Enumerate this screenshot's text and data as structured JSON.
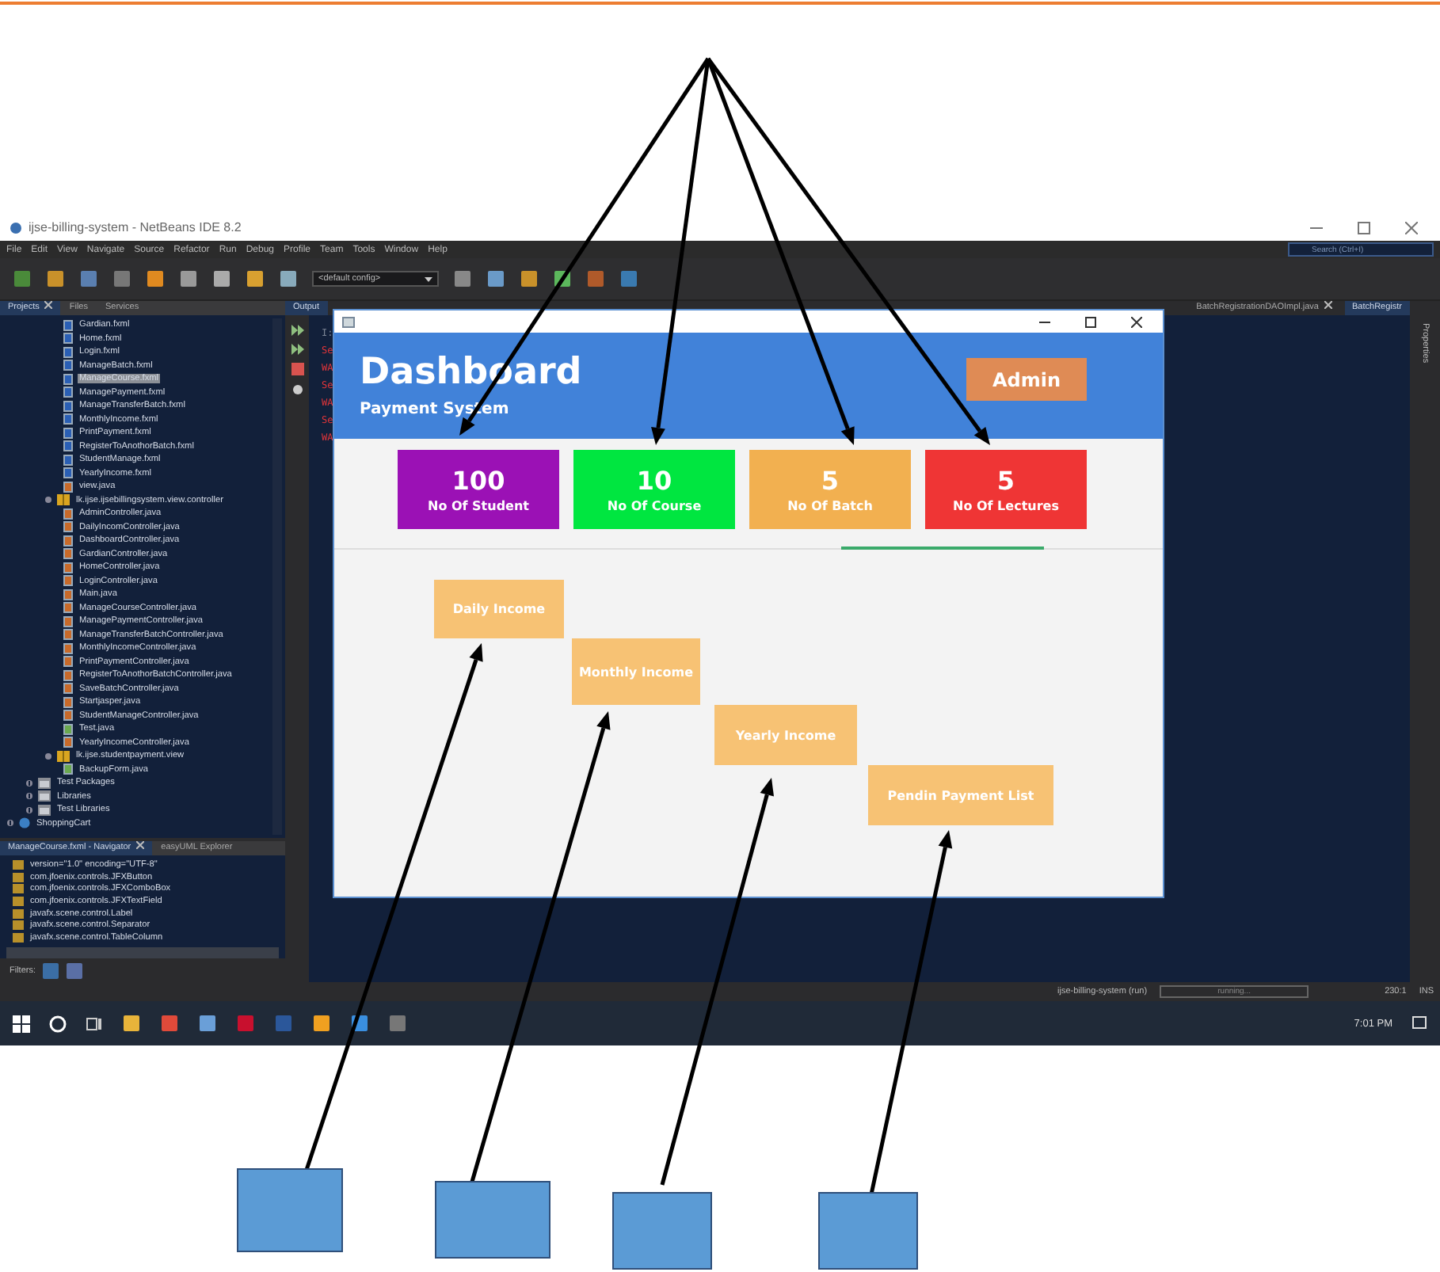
{
  "ide": {
    "title": "ijse-billing-system - NetBeans IDE 8.2",
    "menu": [
      "File",
      "Edit",
      "View",
      "Navigate",
      "Source",
      "Refactor",
      "Run",
      "Debug",
      "Profile",
      "Team",
      "Tools",
      "Window",
      "Help"
    ],
    "search": {
      "placeholder": "Search (Ctrl+I)"
    },
    "config": "<default config>",
    "left_tabs": [
      {
        "label": "Projects",
        "selected": true,
        "closable": true
      },
      {
        "label": "Files",
        "selected": false,
        "closable": false
      },
      {
        "label": "Services",
        "selected": false,
        "closable": false
      }
    ],
    "open_package_files": [
      {
        "label": "Gardian.fxml",
        "kind": "fxml",
        "selected": false
      },
      {
        "label": "Home.fxml",
        "kind": "fxml",
        "selected": false
      },
      {
        "label": "Login.fxml",
        "kind": "fxml",
        "selected": false
      },
      {
        "label": "ManageBatch.fxml",
        "kind": "fxml",
        "selected": false
      },
      {
        "label": "ManageCourse.fxml",
        "kind": "fxml",
        "selected": true
      },
      {
        "label": "ManagePayment.fxml",
        "kind": "fxml",
        "selected": false
      },
      {
        "label": "ManageTransferBatch.fxml",
        "kind": "fxml",
        "selected": false
      },
      {
        "label": "MonthlyIncome.fxml",
        "kind": "fxml",
        "selected": false
      },
      {
        "label": "PrintPayment.fxml",
        "kind": "fxml",
        "selected": false
      },
      {
        "label": "RegisterToAnothorBatch.fxml",
        "kind": "fxml",
        "selected": false
      },
      {
        "label": "StudentManage.fxml",
        "kind": "fxml",
        "selected": false
      },
      {
        "label": "YearlyIncome.fxml",
        "kind": "fxml",
        "selected": false
      },
      {
        "label": "view.java",
        "kind": "java",
        "selected": false
      }
    ],
    "packages": [
      {
        "label": "lk.ijse.ijsebillingsystem.view.controller",
        "expanded": true,
        "children": [
          {
            "label": "AdminController.java",
            "kind": "java",
            "selected": false
          },
          {
            "label": "DailyIncomController.java",
            "kind": "java",
            "selected": false
          },
          {
            "label": "DashboardController.java",
            "kind": "java",
            "selected": false
          },
          {
            "label": "GardianController.java",
            "kind": "java",
            "selected": false
          },
          {
            "label": "HomeController.java",
            "kind": "java",
            "selected": false
          },
          {
            "label": "LoginController.java",
            "kind": "java",
            "selected": false
          },
          {
            "label": "Main.java",
            "kind": "java",
            "selected": false
          },
          {
            "label": "ManageCourseController.java",
            "kind": "java",
            "selected": false
          },
          {
            "label": "ManagePaymentController.java",
            "kind": "java",
            "selected": false
          },
          {
            "label": "ManageTransferBatchController.java",
            "kind": "java",
            "selected": false
          },
          {
            "label": "MonthlyIncomeController.java",
            "kind": "java",
            "selected": false
          },
          {
            "label": "PrintPaymentController.java",
            "kind": "java",
            "selected": false
          },
          {
            "label": "RegisterToAnothorBatchController.java",
            "kind": "java",
            "selected": false
          },
          {
            "label": "SaveBatchController.java",
            "kind": "java",
            "selected": false
          },
          {
            "label": "Startjasper.java",
            "kind": "java",
            "selected": false
          },
          {
            "label": "StudentManageController.java",
            "kind": "java",
            "selected": false
          },
          {
            "label": "Test.java",
            "kind": "form",
            "selected": false
          },
          {
            "label": "YearlyIncomeController.java",
            "kind": "java",
            "selected": false
          }
        ]
      },
      {
        "label": "lk.ijse.studentpayment.view",
        "expanded": true,
        "children": [
          {
            "label": "BackupForm.java",
            "kind": "form",
            "selected": false
          }
        ]
      }
    ],
    "project_folders": [
      {
        "label": "Test Packages",
        "expanded": false
      },
      {
        "label": "Libraries",
        "expanded": false
      },
      {
        "label": "Test Libraries",
        "expanded": false
      }
    ],
    "other_projects": [
      {
        "label": "ShoppingCart",
        "expanded": false
      }
    ],
    "navigator_tabs": [
      {
        "label": "ManageCourse.fxml - Navigator",
        "selected": true,
        "closable": true
      },
      {
        "label": "easyUML Explorer",
        "selected": false,
        "closable": false
      }
    ],
    "navigator_items": [
      "version=\"1.0\" encoding=\"UTF-8\"",
      "com.jfoenix.controls.JFXButton",
      "com.jfoenix.controls.JFXComboBox",
      "com.jfoenix.controls.JFXTextField",
      "javafx.scene.control.Label",
      "javafx.scene.control.Separator",
      "javafx.scene.control.TableColumn"
    ],
    "filters_label": "Filters:",
    "output_tab": "Output",
    "output_lines": [
      {
        "text": "I:",
        "kind": "info"
      },
      {
        "text": "Se",
        "kind": "error"
      },
      {
        "text": "WA",
        "kind": "error"
      },
      {
        "text": "Se",
        "kind": "error"
      },
      {
        "text": "WA",
        "kind": "error"
      },
      {
        "text": "Se",
        "kind": "error"
      },
      {
        "text": "WA",
        "kind": "error"
      }
    ],
    "editor_tabs": [
      {
        "label": "BatchRegistrationDAOImpl.java",
        "selected": false,
        "closable": true
      },
      {
        "label": "BatchRegistr",
        "selected": true,
        "closable": false
      }
    ],
    "side_panel": "Properties",
    "status": {
      "task": "ijse-billing-system (run)",
      "progress": "running...",
      "position": "230:1",
      "mode": "INS"
    },
    "clock": "7:01 PM"
  },
  "dashboard": {
    "title": "Dashboard",
    "subtitle": "Payment System",
    "user_button": "Admin",
    "stats": [
      {
        "value": "100",
        "label": "No Of Student",
        "color": "#9b11b5"
      },
      {
        "value": "10",
        "label": "No Of Course",
        "color": "#00e640"
      },
      {
        "value": "5",
        "label": "No Of Batch",
        "color": "#f2b050"
      },
      {
        "value": "5",
        "label": "No Of Lectures",
        "color": "#ef3535"
      }
    ],
    "reports": [
      "Daily Income",
      "Monthly Income",
      "Yearly Income",
      "Pendin Payment List"
    ]
  }
}
